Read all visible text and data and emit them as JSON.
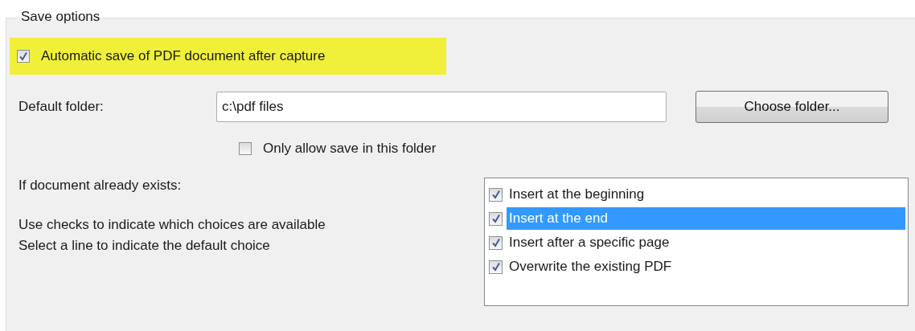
{
  "group": {
    "title": "Save options"
  },
  "auto_save": {
    "label": "Automatic save of PDF document after capture",
    "checked": true,
    "highlighted": true
  },
  "default_folder": {
    "label": "Default folder:",
    "value": "c:\\pdf files"
  },
  "choose_button": {
    "label": "Choose folder..."
  },
  "only_allow": {
    "label": "Only allow save in this folder",
    "checked": false
  },
  "exists_label": "If document already exists:",
  "help_lines": [
    "Use checks to indicate which choices are available",
    "Select a line to indicate the default choice"
  ],
  "choices": [
    {
      "label": "Insert at the beginning",
      "checked": true,
      "selected": false
    },
    {
      "label": "Insert at the end",
      "checked": true,
      "selected": true
    },
    {
      "label": "Insert after a specific page",
      "checked": true,
      "selected": false
    },
    {
      "label": "Overwrite the existing PDF",
      "checked": true,
      "selected": false
    }
  ]
}
